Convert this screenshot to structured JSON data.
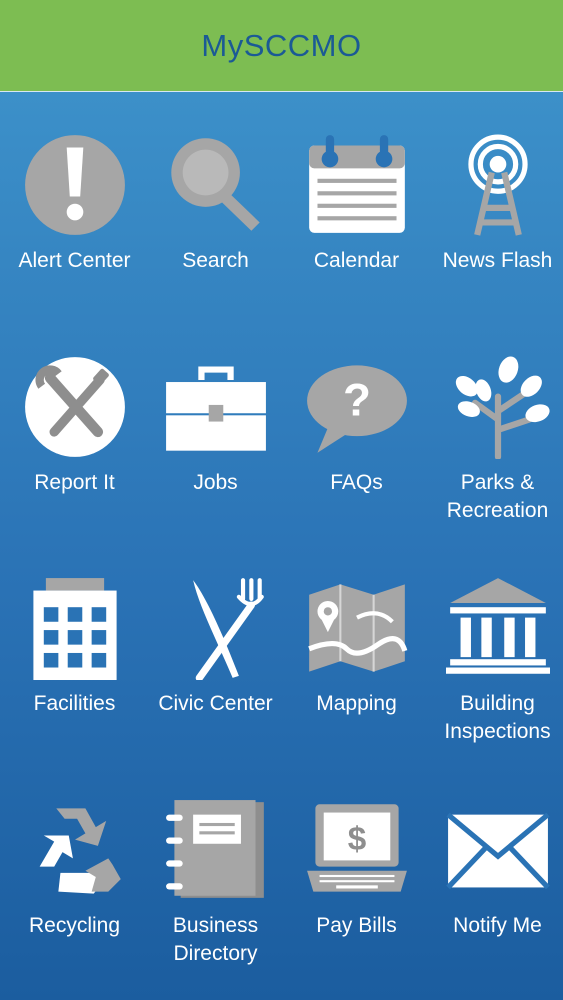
{
  "header": {
    "title": "MySCCMO"
  },
  "tiles": [
    {
      "label": "Alert Center",
      "icon": "alert-icon"
    },
    {
      "label": "Search",
      "icon": "search-icon"
    },
    {
      "label": "Calendar",
      "icon": "calendar-icon"
    },
    {
      "label": "News Flash",
      "icon": "broadcast-tower-icon"
    },
    {
      "label": "Report It",
      "icon": "tools-icon"
    },
    {
      "label": "Jobs",
      "icon": "briefcase-icon"
    },
    {
      "label": "FAQs",
      "icon": "question-bubble-icon"
    },
    {
      "label": "Parks &\nRecreation",
      "icon": "tree-icon"
    },
    {
      "label": "Facilities",
      "icon": "building-icon"
    },
    {
      "label": "Civic Center",
      "icon": "fork-knife-icon"
    },
    {
      "label": "Mapping",
      "icon": "map-icon"
    },
    {
      "label": "Building\nInspections",
      "icon": "courthouse-icon"
    },
    {
      "label": "Recycling",
      "icon": "recycle-icon"
    },
    {
      "label": "Business\nDirectory",
      "icon": "notebook-icon"
    },
    {
      "label": "Pay Bills",
      "icon": "laptop-dollar-icon"
    },
    {
      "label": "Notify Me",
      "icon": "envelope-icon"
    }
  ],
  "colors": {
    "header": "#7dbd52",
    "title": "#1b5a95",
    "icon_gray": "#a6a6a6",
    "icon_white": "#ffffff"
  }
}
